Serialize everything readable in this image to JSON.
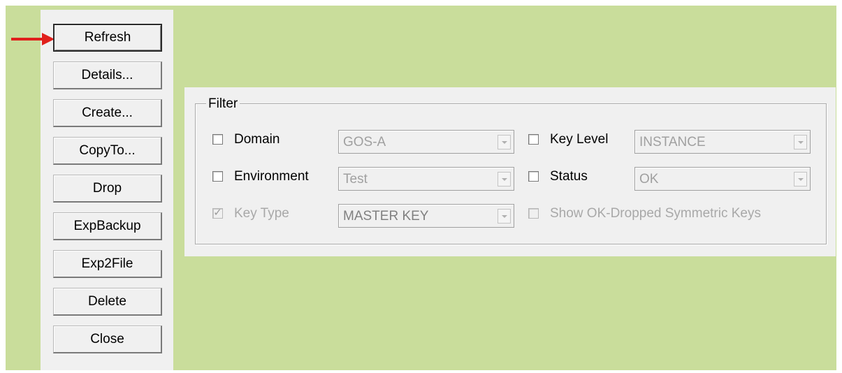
{
  "buttons": {
    "refresh": "Refresh",
    "details": "Details...",
    "create": "Create...",
    "copyto": "CopyTo...",
    "drop": "Drop",
    "expbackup": "ExpBackup",
    "exp2file": "Exp2File",
    "delete": "Delete",
    "close": "Close"
  },
  "filter": {
    "title": "Filter",
    "domain": {
      "label": "Domain",
      "checked": false,
      "value": "GOS-A"
    },
    "environment": {
      "label": "Environment",
      "checked": false,
      "value": "Test"
    },
    "key_type": {
      "label": "Key Type",
      "checked": true,
      "disabled": true,
      "value": "MASTER KEY"
    },
    "key_level": {
      "label": "Key Level",
      "checked": false,
      "value": "INSTANCE"
    },
    "status": {
      "label": "Status",
      "checked": false,
      "value": "OK"
    },
    "show_ok_dropped": {
      "label": "Show OK-Dropped Symmetric Keys",
      "checked": false,
      "disabled": true
    }
  },
  "colors": {
    "background": "#c9dd9b",
    "panel": "#f0f0f0",
    "annotation_arrow": "#e0201c"
  },
  "icons": {
    "annotation": "red-arrow-icon",
    "dropdown": "chevron-down-icon",
    "checkmark": "check-icon"
  }
}
